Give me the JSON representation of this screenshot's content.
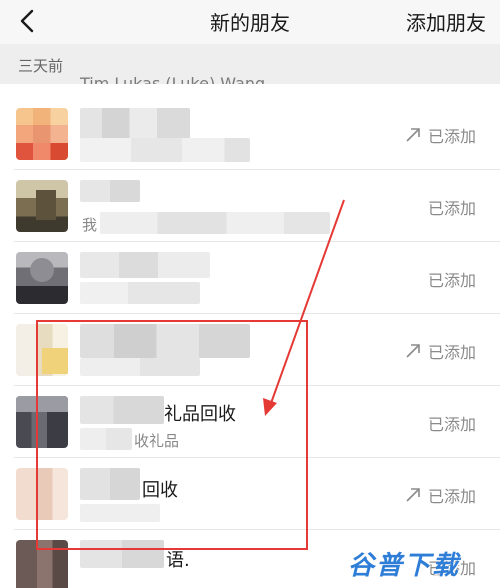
{
  "header": {
    "title": "新的朋友",
    "action_label": "添加朋友"
  },
  "section": {
    "label": "三天前"
  },
  "cut_off_text": "Tim Lukas (Luke) Wang",
  "rows": [
    {
      "name": "",
      "subtitle": "",
      "status": "已添加",
      "arrow": true
    },
    {
      "name": "",
      "subtitle": "我",
      "status": "已添加",
      "arrow": false
    },
    {
      "name": "",
      "subtitle": "",
      "status": "已添加",
      "arrow": false
    },
    {
      "name": "",
      "subtitle": "",
      "status": "已添加",
      "arrow": true
    },
    {
      "name": "礼品回收",
      "subtitle": "收礼品",
      "status": "已添加",
      "arrow": false
    },
    {
      "name": "回收",
      "subtitle": "",
      "status": "已添加",
      "arrow": true
    },
    {
      "name": "语.",
      "subtitle": "",
      "status": "已添加",
      "arrow": false
    }
  ],
  "watermark": "谷普下载",
  "colors": {
    "annotation": "#e53935",
    "watermark": "#2e7dd6",
    "status_text": "#8a8a8a"
  },
  "icons": {
    "back": "chevron-left-icon",
    "added_arrow": "arrow-up-right-icon"
  }
}
